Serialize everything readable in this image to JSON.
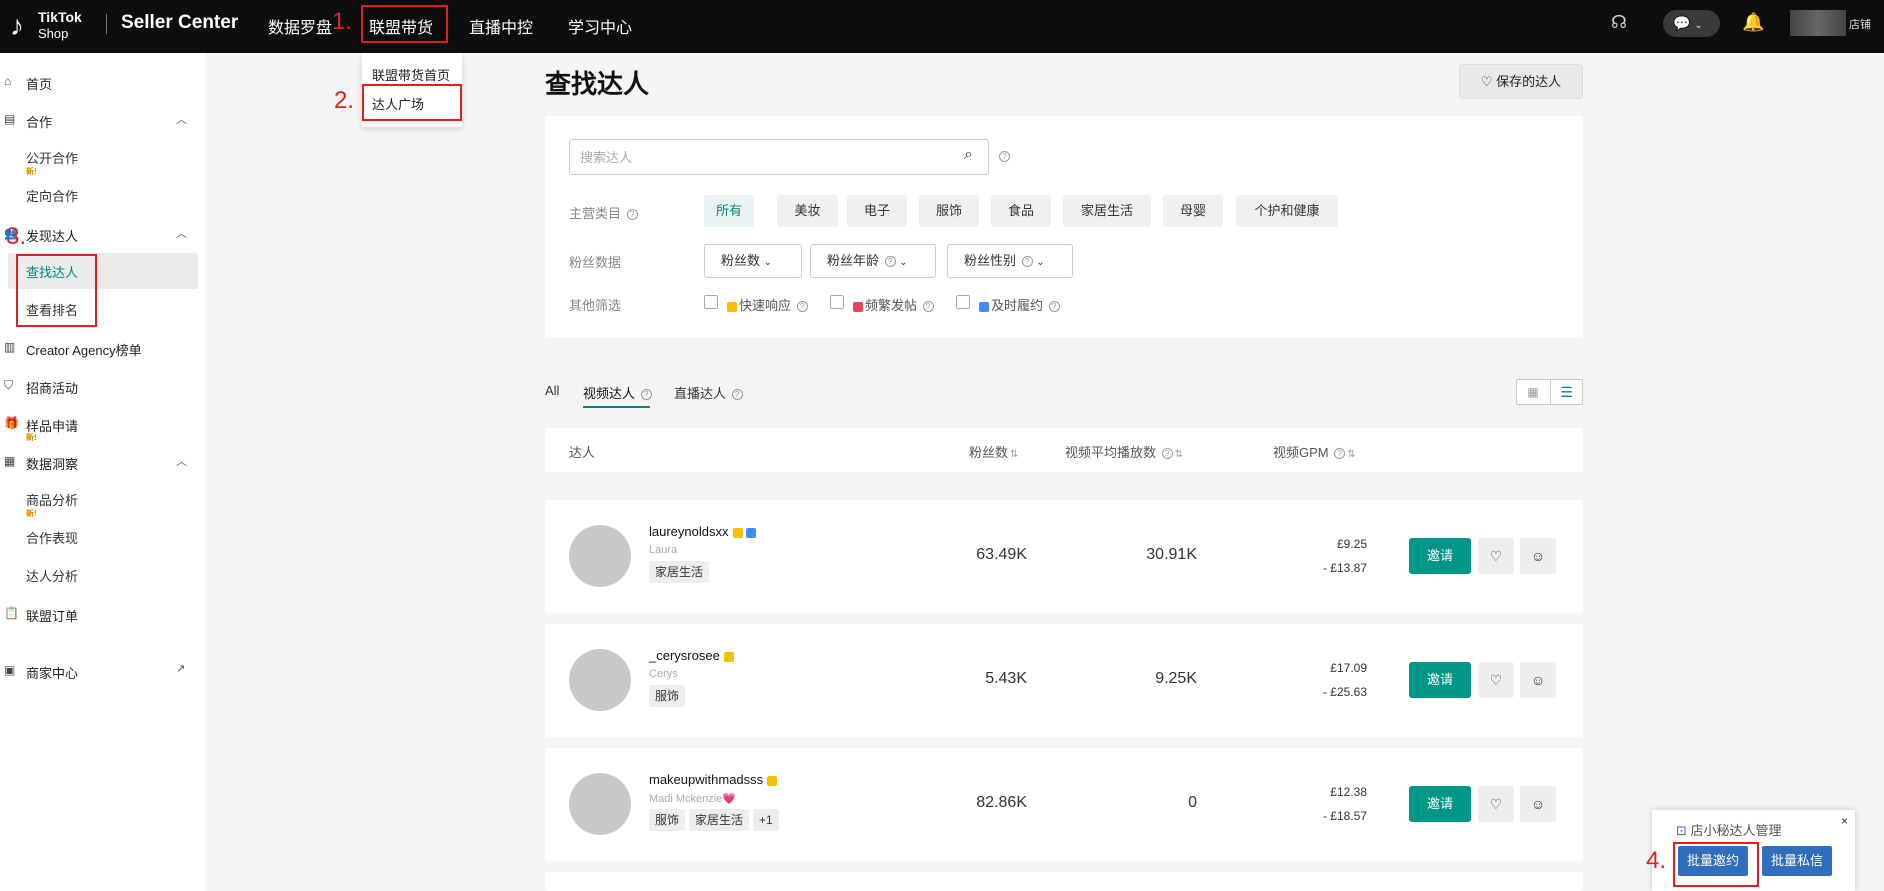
{
  "topbar": {
    "logo_line1": "TikTok",
    "logo_line2": "Shop",
    "title": "Seller Center",
    "nav": [
      "数据罗盘",
      "联盟带货",
      "直播中控",
      "学习中心"
    ],
    "store": "店铺"
  },
  "annotations": [
    "1.",
    "2.",
    "3.",
    "4."
  ],
  "dropdown": [
    "联盟带货首页",
    "达人广场"
  ],
  "sidebar": {
    "home": "首页",
    "cooperation": "合作",
    "public_coop": "公开合作",
    "targeted_coop": "定向合作",
    "discover": "发现达人",
    "find_creator": "查找达人",
    "view_rank": "查看排名",
    "agency": "Creator Agency榜单",
    "campaigns": "招商活动",
    "samples": "样品申请",
    "insights": "数据洞察",
    "product_analysis": "商品分析",
    "coop_perf": "合作表现",
    "creator_analysis": "达人分析",
    "affiliate_orders": "联盟订单",
    "merchant_center": "商家中心",
    "new_badge": "新!"
  },
  "main": {
    "title": "查找达人",
    "saved": "保存的达人",
    "search_placeholder": "搜索达人",
    "category_label": "主营类目",
    "categories": [
      "所有",
      "美妆",
      "电子",
      "服饰",
      "食品",
      "家居生活",
      "母婴",
      "个护和健康"
    ],
    "fans_label": "粉丝数据",
    "fans_selects": [
      "粉丝数",
      "粉丝年龄",
      "粉丝性别"
    ],
    "other_label": "其他筛选",
    "other_filters": [
      "快速响应",
      "频繁发帖",
      "及时履约"
    ],
    "tabs": [
      "All",
      "视频达人",
      "直播达人"
    ],
    "columns": [
      "达人",
      "粉丝数",
      "视频平均播放数",
      "视频GPM"
    ]
  },
  "creators": [
    {
      "name": "laureynoldsxx",
      "sub": "Laura",
      "tags": [
        "家居生活"
      ],
      "fans": "63.49K",
      "plays": "30.91K",
      "gpm_low": "£9.25",
      "gpm_high": "- £13.87",
      "invite": "邀请"
    },
    {
      "name": "_cerysrosee",
      "sub": "Cerys",
      "tags": [
        "服饰"
      ],
      "fans": "5.43K",
      "plays": "9.25K",
      "gpm_low": "£17.09",
      "gpm_high": "- £25.63",
      "invite": "邀请"
    },
    {
      "name": "makeupwithmadsss",
      "sub": "Madi Mckenzie💗",
      "tags": [
        "服饰",
        "家居生活",
        "+1"
      ],
      "fans": "82.86K",
      "plays": "0",
      "gpm_low": "£12.38",
      "gpm_high": "- £18.57",
      "invite": "邀请"
    }
  ],
  "float_panel": {
    "title": "店小秘达人管理",
    "batch_invite": "批量邀约",
    "batch_message": "批量私信",
    "close": "×"
  }
}
